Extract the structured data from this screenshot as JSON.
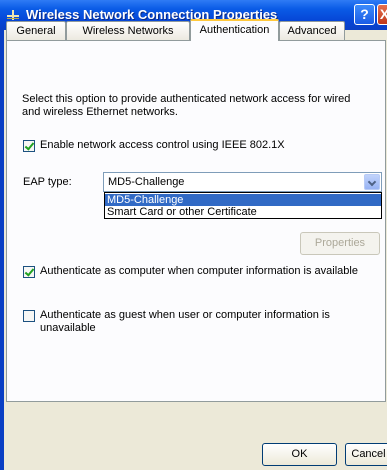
{
  "window": {
    "title": "Wireless Network Connection Properties",
    "help_label": "?",
    "close_label": "X"
  },
  "tabs": [
    {
      "label": "General"
    },
    {
      "label": "Wireless Networks"
    },
    {
      "label": "Authentication",
      "active": true
    },
    {
      "label": "Advanced"
    }
  ],
  "auth": {
    "description": "Select this option to provide authenticated network access for wired and wireless Ethernet networks.",
    "enable_8021x": {
      "label": "Enable network access control using IEEE 802.1X",
      "checked": true
    },
    "eap_type": {
      "label": "EAP type:",
      "value": "MD5-Challenge",
      "options": [
        "MD5-Challenge",
        "Smart Card or other Certificate"
      ]
    },
    "properties_label": "Properties",
    "auth_computer": {
      "label": "Authenticate as computer when computer information is available",
      "checked": true
    },
    "auth_guest": {
      "label": "Authenticate as guest when user or computer information is unavailable",
      "checked": false
    }
  },
  "buttons": {
    "ok": "OK",
    "cancel": "Cancel"
  },
  "colors": {
    "titlebar": "#0a5be6",
    "dialog": "#ece9d8",
    "selection": "#316ac5"
  }
}
